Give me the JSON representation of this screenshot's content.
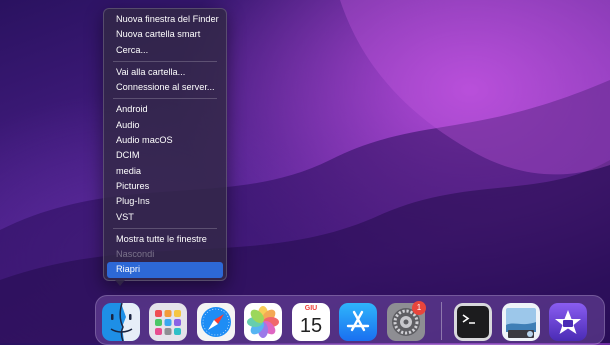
{
  "context_menu": {
    "items": [
      {
        "label": "Nuova finestra del Finder"
      },
      {
        "label": "Nuova cartella smart"
      },
      {
        "label": "Cerca..."
      },
      {
        "separator": true
      },
      {
        "label": "Vai alla cartella..."
      },
      {
        "label": "Connessione al server..."
      },
      {
        "separator": true
      },
      {
        "label": "Android"
      },
      {
        "label": "Audio"
      },
      {
        "label": "Audio macOS"
      },
      {
        "label": "DCIM"
      },
      {
        "label": "media"
      },
      {
        "label": "Pictures"
      },
      {
        "label": "Plug-Ins"
      },
      {
        "label": "VST"
      },
      {
        "separator": true
      },
      {
        "label": "Mostra tutte le finestre"
      },
      {
        "label": "Nascondi",
        "disabled": true
      },
      {
        "label": "Riapri",
        "selected": true
      }
    ]
  },
  "dock": {
    "apps": [
      {
        "name": "finder-icon"
      },
      {
        "name": "launchpad-icon"
      },
      {
        "name": "safari-icon"
      },
      {
        "name": "photos-icon"
      },
      {
        "name": "calendar-icon",
        "month": "GIU",
        "day": "15"
      },
      {
        "name": "app-store-icon"
      },
      {
        "name": "system-preferences-icon",
        "badge": "1"
      },
      {
        "name": "terminal-icon"
      },
      {
        "name": "preview-icon"
      },
      {
        "name": "imovie-icon"
      }
    ]
  },
  "colors": {
    "selection": "#2d68d6",
    "badge": "#e8453c"
  }
}
